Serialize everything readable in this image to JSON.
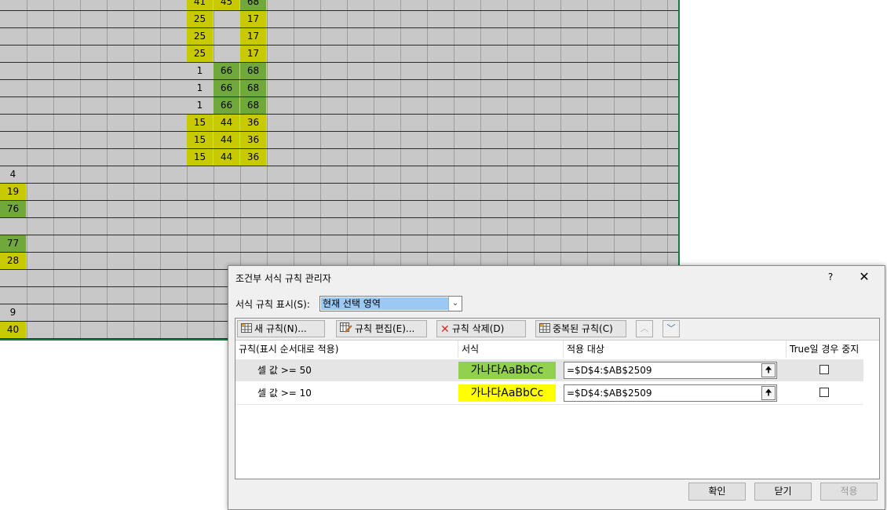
{
  "sheet": {
    "rows": [
      {
        "cells": [
          {
            "col": 7,
            "v": "41",
            "c": "y"
          },
          {
            "col": 8,
            "v": "45",
            "c": "y"
          },
          {
            "col": 9,
            "v": "68",
            "c": "g"
          }
        ]
      },
      {
        "cells": [
          {
            "col": 7,
            "v": "25",
            "c": "y"
          },
          {
            "col": 9,
            "v": "17",
            "c": "y"
          }
        ]
      },
      {
        "cells": [
          {
            "col": 7,
            "v": "25",
            "c": "y"
          },
          {
            "col": 9,
            "v": "17",
            "c": "y"
          }
        ]
      },
      {
        "cells": [
          {
            "col": 7,
            "v": "25",
            "c": "y"
          },
          {
            "col": 9,
            "v": "17",
            "c": "y"
          }
        ]
      },
      {
        "cells": [
          {
            "col": 7,
            "v": "1",
            "c": "p"
          },
          {
            "col": 8,
            "v": "66",
            "c": "g"
          },
          {
            "col": 9,
            "v": "68",
            "c": "g"
          }
        ]
      },
      {
        "cells": [
          {
            "col": 7,
            "v": "1",
            "c": "p"
          },
          {
            "col": 8,
            "v": "66",
            "c": "g"
          },
          {
            "col": 9,
            "v": "68",
            "c": "g"
          }
        ]
      },
      {
        "cells": [
          {
            "col": 7,
            "v": "1",
            "c": "p"
          },
          {
            "col": 8,
            "v": "66",
            "c": "g"
          },
          {
            "col": 9,
            "v": "68",
            "c": "g"
          }
        ]
      },
      {
        "cells": [
          {
            "col": 7,
            "v": "15",
            "c": "y"
          },
          {
            "col": 8,
            "v": "44",
            "c": "y"
          },
          {
            "col": 9,
            "v": "36",
            "c": "y"
          }
        ]
      },
      {
        "cells": [
          {
            "col": 7,
            "v": "15",
            "c": "y"
          },
          {
            "col": 8,
            "v": "44",
            "c": "y"
          },
          {
            "col": 9,
            "v": "36",
            "c": "y"
          }
        ]
      },
      {
        "cells": [
          {
            "col": 7,
            "v": "15",
            "c": "y"
          },
          {
            "col": 8,
            "v": "44",
            "c": "y"
          },
          {
            "col": 9,
            "v": "36",
            "c": "y"
          }
        ]
      },
      {
        "cells": [
          {
            "col": 0,
            "v": "4",
            "c": "p"
          }
        ]
      },
      {
        "cells": [
          {
            "col": 0,
            "v": "19",
            "c": "y"
          }
        ]
      },
      {
        "cells": [
          {
            "col": 0,
            "v": "76",
            "c": "g"
          }
        ]
      },
      {
        "cells": []
      },
      {
        "cells": [
          {
            "col": 0,
            "v": "77",
            "c": "g"
          }
        ]
      },
      {
        "cells": [
          {
            "col": 0,
            "v": "28",
            "c": "y"
          }
        ]
      },
      {
        "cells": []
      },
      {
        "cells": []
      },
      {
        "cells": [
          {
            "col": 0,
            "v": "9",
            "c": "p"
          }
        ]
      },
      {
        "cells": [
          {
            "col": 0,
            "v": "40",
            "c": "y"
          }
        ]
      }
    ]
  },
  "colors": {
    "yellow": "#c9c900",
    "green": "#70a83c",
    "fmt_green": "#92d050",
    "fmt_yellow": "#ffff00"
  },
  "dialog": {
    "title": "조건부 서식 규칙 관리자",
    "help": "?",
    "close": "✕",
    "show_label": "서식 규칙 표시(S):",
    "show_value": "현재 선택 영역",
    "toolbar": {
      "new_rule": "새 규칙(N)...",
      "edit_rule": "규칙 편집(E)...",
      "delete_rule": "규칙 삭제(D)",
      "duplicate_rule": "중복된 규칙(C)"
    },
    "columns": {
      "rule": "규칙(표시 순서대로 적용)",
      "format": "서식",
      "applies_to": "적용 대상",
      "stop_if_true": "True일 경우 중지"
    },
    "rules": [
      {
        "name": "셀 값 >= 50",
        "preview": "가나다AaBbCc",
        "range": "=$D$4:$AB$2509",
        "stop": false
      },
      {
        "name": "셀 값 >= 10",
        "preview": "가나다AaBbCc",
        "range": "=$D$4:$AB$2509",
        "stop": false
      }
    ],
    "buttons": {
      "ok": "확인",
      "close": "닫기",
      "apply": "적용"
    }
  }
}
